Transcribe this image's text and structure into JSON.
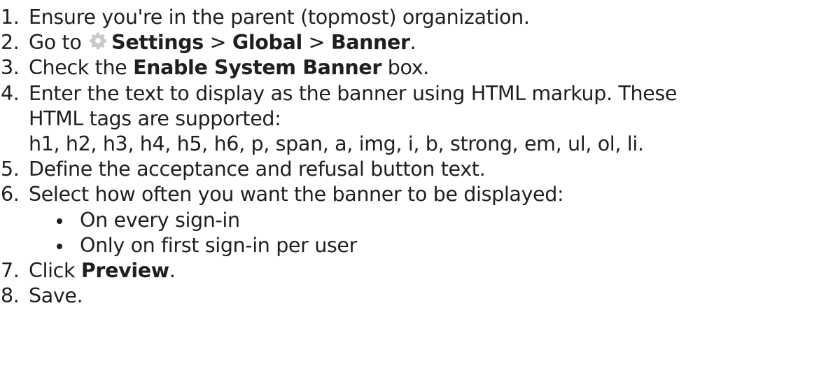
{
  "steps": [
    {
      "num": "1.",
      "text": "Ensure you're in the parent (topmost) organization."
    },
    {
      "num": "2.",
      "pre": "Go to ",
      "icon": "gear-icon",
      "b1": "Settings",
      "sep1": " > ",
      "b2": "Global",
      "sep2": " > ",
      "b3": "Banner",
      "post": "."
    },
    {
      "num": "3.",
      "pre": "Check the ",
      "bold": "Enable System Banner",
      "post": " box."
    },
    {
      "num": "4.",
      "line1": "Enter the text to display as the banner using HTML markup. These",
      "line2": "HTML tags are supported:",
      "line3": "h1, h2, h3, h4, h5, h6, p, span, a, img, i, b, strong, em, ul, ol, li."
    },
    {
      "num": "5.",
      "text": "Define the acceptance and refusal button text."
    },
    {
      "num": "6.",
      "text": "Select how often you want the banner to be displayed:",
      "options": [
        "On every sign-in",
        "Only on first sign-in per user"
      ]
    },
    {
      "num": "7.",
      "pre": "Click ",
      "bold": "Preview",
      "post": "."
    },
    {
      "num": "8.",
      "text": "Save."
    }
  ],
  "colors": {
    "text": "#1f1f1f",
    "gear": "#c9c9c9"
  }
}
